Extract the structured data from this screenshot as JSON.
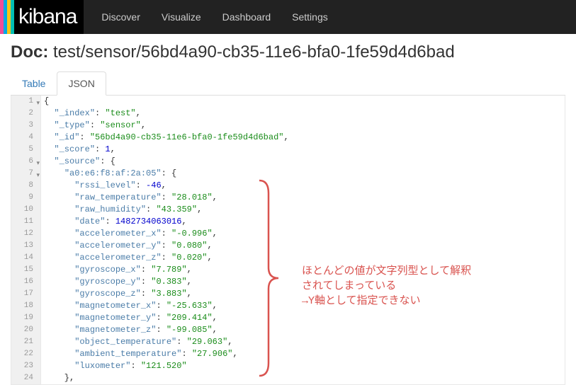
{
  "nav": {
    "logo_text": "kibana",
    "items": [
      "Discover",
      "Visualize",
      "Dashboard",
      "Settings"
    ]
  },
  "doc": {
    "prefix": "Doc:",
    "path": "test/sensor/56bd4a90-cb35-11e6-bfa0-1fe59d4d6bad"
  },
  "tabs": {
    "table": "Table",
    "json": "JSON"
  },
  "json_lines": [
    {
      "n": 1,
      "fold": true,
      "tokens": [
        {
          "t": "pun",
          "v": "{"
        }
      ]
    },
    {
      "n": 2,
      "tokens": [
        {
          "t": "pun",
          "v": "  "
        },
        {
          "t": "key",
          "v": "\"_index\""
        },
        {
          "t": "pun",
          "v": ": "
        },
        {
          "t": "str",
          "v": "\"test\""
        },
        {
          "t": "pun",
          "v": ","
        }
      ]
    },
    {
      "n": 3,
      "tokens": [
        {
          "t": "pun",
          "v": "  "
        },
        {
          "t": "key",
          "v": "\"_type\""
        },
        {
          "t": "pun",
          "v": ": "
        },
        {
          "t": "str",
          "v": "\"sensor\""
        },
        {
          "t": "pun",
          "v": ","
        }
      ]
    },
    {
      "n": 4,
      "tokens": [
        {
          "t": "pun",
          "v": "  "
        },
        {
          "t": "key",
          "v": "\"_id\""
        },
        {
          "t": "pun",
          "v": ": "
        },
        {
          "t": "str",
          "v": "\"56bd4a90-cb35-11e6-bfa0-1fe59d4d6bad\""
        },
        {
          "t": "pun",
          "v": ","
        }
      ]
    },
    {
      "n": 5,
      "tokens": [
        {
          "t": "pun",
          "v": "  "
        },
        {
          "t": "key",
          "v": "\"_score\""
        },
        {
          "t": "pun",
          "v": ": "
        },
        {
          "t": "num",
          "v": "1"
        },
        {
          "t": "pun",
          "v": ","
        }
      ]
    },
    {
      "n": 6,
      "fold": true,
      "tokens": [
        {
          "t": "pun",
          "v": "  "
        },
        {
          "t": "key",
          "v": "\"_source\""
        },
        {
          "t": "pun",
          "v": ": {"
        }
      ]
    },
    {
      "n": 7,
      "fold": true,
      "tokens": [
        {
          "t": "pun",
          "v": "    "
        },
        {
          "t": "key",
          "v": "\"a0:e6:f8:af:2a:05\""
        },
        {
          "t": "pun",
          "v": ": {"
        }
      ]
    },
    {
      "n": 8,
      "tokens": [
        {
          "t": "pun",
          "v": "      "
        },
        {
          "t": "key",
          "v": "\"rssi_level\""
        },
        {
          "t": "pun",
          "v": ": "
        },
        {
          "t": "num",
          "v": "-46"
        },
        {
          "t": "pun",
          "v": ","
        }
      ]
    },
    {
      "n": 9,
      "tokens": [
        {
          "t": "pun",
          "v": "      "
        },
        {
          "t": "key",
          "v": "\"raw_temperature\""
        },
        {
          "t": "pun",
          "v": ": "
        },
        {
          "t": "str",
          "v": "\"28.018\""
        },
        {
          "t": "pun",
          "v": ","
        }
      ]
    },
    {
      "n": 10,
      "tokens": [
        {
          "t": "pun",
          "v": "      "
        },
        {
          "t": "key",
          "v": "\"raw_humidity\""
        },
        {
          "t": "pun",
          "v": ": "
        },
        {
          "t": "str",
          "v": "\"43.359\""
        },
        {
          "t": "pun",
          "v": ","
        }
      ]
    },
    {
      "n": 11,
      "tokens": [
        {
          "t": "pun",
          "v": "      "
        },
        {
          "t": "key",
          "v": "\"date\""
        },
        {
          "t": "pun",
          "v": ": "
        },
        {
          "t": "num",
          "v": "1482734063016"
        },
        {
          "t": "pun",
          "v": ","
        }
      ]
    },
    {
      "n": 12,
      "tokens": [
        {
          "t": "pun",
          "v": "      "
        },
        {
          "t": "key",
          "v": "\"accelerometer_x\""
        },
        {
          "t": "pun",
          "v": ": "
        },
        {
          "t": "str",
          "v": "\"-0.996\""
        },
        {
          "t": "pun",
          "v": ","
        }
      ]
    },
    {
      "n": 13,
      "tokens": [
        {
          "t": "pun",
          "v": "      "
        },
        {
          "t": "key",
          "v": "\"accelerometer_y\""
        },
        {
          "t": "pun",
          "v": ": "
        },
        {
          "t": "str",
          "v": "\"0.080\""
        },
        {
          "t": "pun",
          "v": ","
        }
      ]
    },
    {
      "n": 14,
      "tokens": [
        {
          "t": "pun",
          "v": "      "
        },
        {
          "t": "key",
          "v": "\"accelerometer_z\""
        },
        {
          "t": "pun",
          "v": ": "
        },
        {
          "t": "str",
          "v": "\"0.020\""
        },
        {
          "t": "pun",
          "v": ","
        }
      ]
    },
    {
      "n": 15,
      "tokens": [
        {
          "t": "pun",
          "v": "      "
        },
        {
          "t": "key",
          "v": "\"gyroscope_x\""
        },
        {
          "t": "pun",
          "v": ": "
        },
        {
          "t": "str",
          "v": "\"7.789\""
        },
        {
          "t": "pun",
          "v": ","
        }
      ]
    },
    {
      "n": 16,
      "tokens": [
        {
          "t": "pun",
          "v": "      "
        },
        {
          "t": "key",
          "v": "\"gyroscope_y\""
        },
        {
          "t": "pun",
          "v": ": "
        },
        {
          "t": "str",
          "v": "\"0.383\""
        },
        {
          "t": "pun",
          "v": ","
        }
      ]
    },
    {
      "n": 17,
      "tokens": [
        {
          "t": "pun",
          "v": "      "
        },
        {
          "t": "key",
          "v": "\"gyroscope_z\""
        },
        {
          "t": "pun",
          "v": ": "
        },
        {
          "t": "str",
          "v": "\"3.883\""
        },
        {
          "t": "pun",
          "v": ","
        }
      ]
    },
    {
      "n": 18,
      "tokens": [
        {
          "t": "pun",
          "v": "      "
        },
        {
          "t": "key",
          "v": "\"magnetometer_x\""
        },
        {
          "t": "pun",
          "v": ": "
        },
        {
          "t": "str",
          "v": "\"-25.633\""
        },
        {
          "t": "pun",
          "v": ","
        }
      ]
    },
    {
      "n": 19,
      "tokens": [
        {
          "t": "pun",
          "v": "      "
        },
        {
          "t": "key",
          "v": "\"magnetometer_y\""
        },
        {
          "t": "pun",
          "v": ": "
        },
        {
          "t": "str",
          "v": "\"209.414\""
        },
        {
          "t": "pun",
          "v": ","
        }
      ]
    },
    {
      "n": 20,
      "tokens": [
        {
          "t": "pun",
          "v": "      "
        },
        {
          "t": "key",
          "v": "\"magnetometer_z\""
        },
        {
          "t": "pun",
          "v": ": "
        },
        {
          "t": "str",
          "v": "\"-99.085\""
        },
        {
          "t": "pun",
          "v": ","
        }
      ]
    },
    {
      "n": 21,
      "tokens": [
        {
          "t": "pun",
          "v": "      "
        },
        {
          "t": "key",
          "v": "\"object_temperature\""
        },
        {
          "t": "pun",
          "v": ": "
        },
        {
          "t": "str",
          "v": "\"29.063\""
        },
        {
          "t": "pun",
          "v": ","
        }
      ]
    },
    {
      "n": 22,
      "tokens": [
        {
          "t": "pun",
          "v": "      "
        },
        {
          "t": "key",
          "v": "\"ambient_temperature\""
        },
        {
          "t": "pun",
          "v": ": "
        },
        {
          "t": "str",
          "v": "\"27.906\""
        },
        {
          "t": "pun",
          "v": ","
        }
      ]
    },
    {
      "n": 23,
      "tokens": [
        {
          "t": "pun",
          "v": "      "
        },
        {
          "t": "key",
          "v": "\"luxometer\""
        },
        {
          "t": "pun",
          "v": ": "
        },
        {
          "t": "str",
          "v": "\"121.520\""
        }
      ]
    },
    {
      "n": 24,
      "tokens": [
        {
          "t": "pun",
          "v": "    },"
        }
      ]
    }
  ],
  "annotation": {
    "line1": "ほとんどの値が文字列型として解釈",
    "line2": "されてしまっている",
    "line3": "→Y軸として指定できない"
  }
}
